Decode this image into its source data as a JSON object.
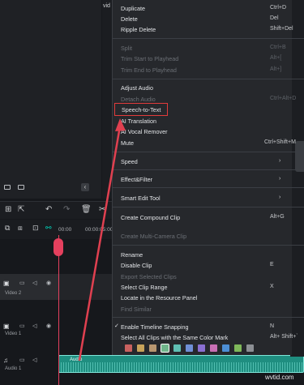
{
  "left_panel": {
    "collapse_symbol": "‹"
  },
  "mid_panel": {
    "text": "vid"
  },
  "menu": {
    "items": [
      {
        "label": "Duplicate",
        "shortcut": "Ctrl+D",
        "enabled": true
      },
      {
        "label": "Delete",
        "shortcut": "Del",
        "enabled": true
      },
      {
        "label": "Ripple Delete",
        "shortcut": "Shift+Del",
        "enabled": true
      },
      {
        "label": "Split",
        "shortcut": "Ctrl+B",
        "enabled": false
      },
      {
        "label": "Trim Start to Playhead",
        "shortcut": "Alt+[",
        "enabled": false
      },
      {
        "label": "Trim End to Playhead",
        "shortcut": "Alt+]",
        "enabled": false
      },
      {
        "label": "Adjust Audio",
        "shortcut": "",
        "enabled": true
      },
      {
        "label": "Detach Audio",
        "shortcut": "Ctrl+Alt+D",
        "enabled": false
      },
      {
        "label": "Speech-to-Text",
        "shortcut": "",
        "enabled": true
      },
      {
        "label": "AI Translation",
        "shortcut": "",
        "enabled": true
      },
      {
        "label": "AI Vocal Remover",
        "shortcut": "",
        "enabled": true
      },
      {
        "label": "Mute",
        "shortcut": "Ctrl+Shift+M",
        "enabled": true
      },
      {
        "label": "Speed",
        "shortcut": "",
        "enabled": true
      },
      {
        "label": "Effect&Filter",
        "shortcut": "",
        "enabled": true
      },
      {
        "label": "Smart Edit Tool",
        "shortcut": "",
        "enabled": true
      },
      {
        "label": "Create Compound Clip",
        "shortcut": "Alt+G",
        "enabled": true
      },
      {
        "label": "Create Multi-Camera Clip",
        "shortcut": "",
        "enabled": false
      },
      {
        "label": "Rename",
        "shortcut": "",
        "enabled": true
      },
      {
        "label": "Disable Clip",
        "shortcut": "E",
        "enabled": true
      },
      {
        "label": "Export Selected Clips",
        "shortcut": "",
        "enabled": false
      },
      {
        "label": "Select Clip Range",
        "shortcut": "X",
        "enabled": true
      },
      {
        "label": "Locate in the Resource Panel",
        "shortcut": "",
        "enabled": true
      },
      {
        "label": "Find Similar",
        "shortcut": "",
        "enabled": false
      },
      {
        "label": "Enable Timeline Snapping",
        "shortcut": "N",
        "enabled": true,
        "checked": true
      },
      {
        "label": "Select All Clips with the Same Color Mark",
        "shortcut": "Alt+ Shift+`",
        "enabled": true
      }
    ],
    "highlighted_item": "Speech-to-Text",
    "color_marks": [
      "#c8615f",
      "#c7a35a",
      "#b89770",
      "#6fb58b",
      "#5fbfb3",
      "#6f8fd6",
      "#8a6fd1",
      "#c86fb4",
      "#4c8ed4",
      "#7fb85a",
      "#8c8f94"
    ]
  },
  "timeline": {
    "time_start": "00:00",
    "time_second": "00:00:05:00",
    "tracks": [
      {
        "name": "Video 2"
      },
      {
        "name": "Video 1"
      },
      {
        "name": "Audio 1"
      }
    ],
    "audio_clip_label": "Audio"
  },
  "colors": {
    "accent": "#00d1b8",
    "playhead": "#e5405e",
    "highlight_box": "#e23b3b",
    "arrow": "#e04050",
    "menu_bg": "#26282c"
  },
  "watermark": "wvtid.com"
}
